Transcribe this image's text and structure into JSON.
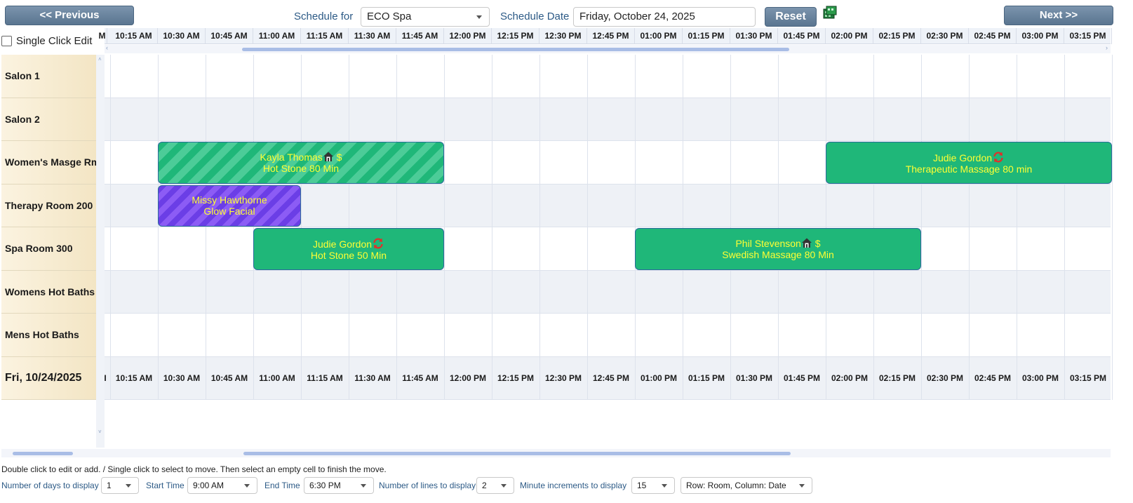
{
  "header": {
    "prev_label": "<< Previous",
    "next_label": "Next >>",
    "schedule_for_label": "Schedule for",
    "schedule_for_value": "ECO Spa",
    "schedule_date_label": "Schedule Date",
    "schedule_date_value": "Friday, October 24, 2025",
    "reset_label": "Reset",
    "calendar_icon": "calendar-icon"
  },
  "single_click_edit_label": "Single Click Edit",
  "times": [
    "10:15 AM",
    "10:30 AM",
    "10:45 AM",
    "11:00 AM",
    "11:15 AM",
    "11:30 AM",
    "11:45 AM",
    "12:00 PM",
    "12:15 PM",
    "12:30 PM",
    "12:45 PM",
    "01:00 PM",
    "01:15 PM",
    "01:30 PM",
    "01:45 PM",
    "02:00 PM",
    "02:15 PM",
    "02:30 PM",
    "02:45 PM",
    "03:00 PM",
    "03:15 PM"
  ],
  "rooms": [
    "Salon 1",
    "Salon 2",
    "Women's Masge Rm",
    "Therapy Room 200",
    "Spa Room 300",
    "Womens Hot Baths",
    "Mens Hot Baths"
  ],
  "date_row_label": "Fri, 10/24/2025",
  "appointments": [
    {
      "client": "Kayla Thomas",
      "service": "Hot Stone 80 Min",
      "room": 2,
      "start": 1,
      "span": 6,
      "style": "stripe-green",
      "icons": [
        "home",
        "dollar"
      ]
    },
    {
      "client": "Judie Gordon",
      "service": "Therapeutic Massage 80 min",
      "room": 2,
      "start": 15,
      "span": 6,
      "style": "solid-green",
      "icons": [
        "sync"
      ]
    },
    {
      "client": "Missy Hawthorne",
      "service": "Glow Facial",
      "room": 3,
      "start": 1,
      "span": 3,
      "style": "stripe-purple",
      "icons": []
    },
    {
      "client": "Judie Gordon",
      "service": "Hot Stone 50 Min",
      "room": 4,
      "start": 3,
      "span": 4,
      "style": "solid-green",
      "icons": [
        "sync"
      ]
    },
    {
      "client": "Phil Stevenson",
      "service": "Swedish Massage 80 Min",
      "room": 4,
      "start": 11,
      "span": 6,
      "style": "solid-green",
      "icons": [
        "home",
        "dollar"
      ]
    }
  ],
  "help_text": "Double click to edit or add. / Single click to select to move. Then select an empty cell to finish the move.",
  "controls": {
    "days_label": "Number of days to display",
    "days_value": "1",
    "start_label": "Start Time",
    "start_value": "9:00 AM",
    "end_label": "End Time",
    "end_value": "6:30 PM",
    "lines_label": "Number of lines to display",
    "lines_value": "2",
    "minutes_label": "Minute increments to display",
    "minutes_value": "15",
    "layout_value": "Row: Room, Column: Date"
  },
  "colors": {
    "accent": "#5a7590",
    "green": "#1fb779",
    "purple": "#6b3ee6",
    "appt_text": "#ffff33"
  }
}
